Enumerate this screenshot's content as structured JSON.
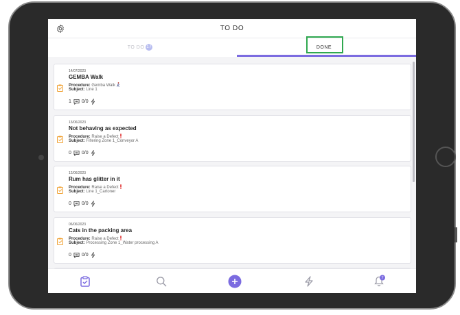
{
  "header": {
    "title": "TO DO",
    "settings_icon": "gear-icon"
  },
  "tabs": [
    {
      "label": "TO DO",
      "badge": "17",
      "active": false
    },
    {
      "label": "DONE",
      "active": true
    }
  ],
  "colors": {
    "accent": "#7b6be0",
    "card_icon": "#f0a030",
    "highlight": "#2fa84f",
    "bell_badge": "#7b6be0"
  },
  "cards": [
    {
      "date": "14/07/2023",
      "title": "GEMBA Walk",
      "procedure_label": "Procedure:",
      "procedure": "Gemba Walk",
      "procedure_icon": "walking-person-icon",
      "subject_label": "Subject:",
      "subject": "Line 1",
      "comments": "1",
      "actions": "0/0"
    },
    {
      "date": "13/06/2023",
      "title": "Not behaving as expected",
      "procedure_label": "Procedure:",
      "procedure": "Raise a Defect",
      "procedure_icon": "exclamation-icon",
      "subject_label": "Subject:",
      "subject": "Filtering Zone 1_Conveyor A",
      "comments": "0",
      "actions": "0/0"
    },
    {
      "date": "12/06/2023",
      "title": "Rum has glitter in it",
      "procedure_label": "Procedure:",
      "procedure": "Raise a Defect",
      "procedure_icon": "exclamation-icon",
      "subject_label": "Subject:",
      "subject": "Line 1_Cartoner",
      "comments": "0",
      "actions": "0/0"
    },
    {
      "date": "06/06/2023",
      "title": "Cats in the packing area",
      "procedure_label": "Procedure:",
      "procedure": "Raise a Defect",
      "procedure_icon": "exclamation-icon",
      "subject_label": "Subject:",
      "subject": "Processing Zone 1_Water processing A",
      "comments": "0",
      "actions": "0/0"
    }
  ],
  "bottom_nav": [
    {
      "icon": "clipboard-check-icon",
      "active": true
    },
    {
      "icon": "search-icon"
    },
    {
      "icon": "plus-circle-icon"
    },
    {
      "icon": "lightning-icon"
    },
    {
      "icon": "bell-icon",
      "badge": "7"
    }
  ]
}
